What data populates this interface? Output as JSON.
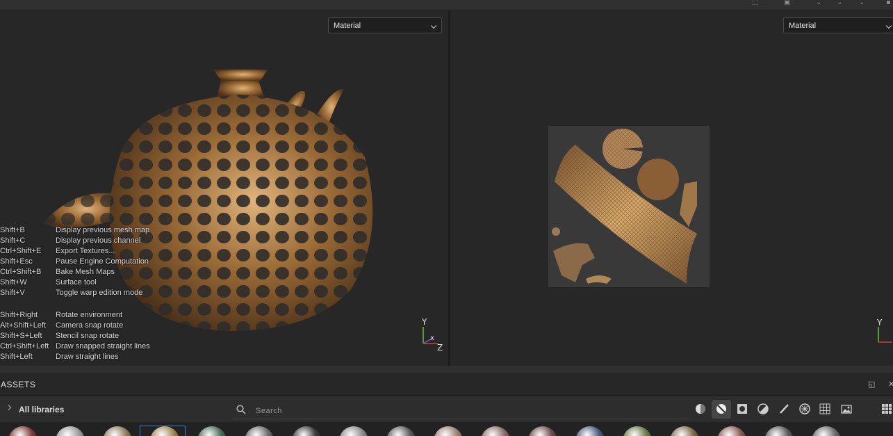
{
  "viewport3d": {
    "channel_dropdown": "Material"
  },
  "viewport2d": {
    "channel_dropdown": "Material"
  },
  "shortcuts_group1": [
    {
      "key": "Shift+B",
      "action": "Display previous mesh map"
    },
    {
      "key": "Shift+C",
      "action": "Display previous channel"
    },
    {
      "key": "Ctrl+Shift+E",
      "action": "Export Textures..."
    },
    {
      "key": "Shift+Esc",
      "action": "Pause Engine Computation"
    },
    {
      "key": "Ctrl+Shift+B",
      "action": "Bake Mesh Maps"
    },
    {
      "key": "Shift+W",
      "action": "Surface tool"
    },
    {
      "key": "Shift+V",
      "action": "Toggle warp edition mode"
    }
  ],
  "shortcuts_group2": [
    {
      "key": "Shift+Right",
      "action": "Rotate environment"
    },
    {
      "key": "Alt+Shift+Left",
      "action": "Camera snap rotate"
    },
    {
      "key": "Shift+S+Left",
      "action": "Stencil snap rotate"
    },
    {
      "key": "Ctrl+Shift+Left",
      "action": "Draw snapped straight lines"
    },
    {
      "key": "Shift+Left",
      "action": "Draw straight lines"
    }
  ],
  "gizmo3d": {
    "y": "Y",
    "x": "x",
    "z": "Z"
  },
  "gizmo2d": {
    "y": "Y"
  },
  "assets": {
    "title": "ASSETS",
    "library": "All libraries",
    "search_placeholder": "Search"
  },
  "filters": [
    "materials-filter",
    "smart-materials-filter",
    "textures-filter",
    "masks-filter",
    "brushes-filter",
    "patterns-filter",
    "grids-filter",
    "environments-filter"
  ],
  "thumb_colors": [
    "#7a3a3a",
    "#9a9a9a",
    "#8a7a5a",
    "#a08850",
    "#4a6a5a",
    "#6a6a6a",
    "#3a3a3a",
    "#8a8a8a",
    "#5a5a5a",
    "#9a8070",
    "#8a6a6a",
    "#6a4a4a",
    "#4a5a7a",
    "#6a7a4a",
    "#7a6a4a",
    "#8a5a5a",
    "#5a5a5a",
    "#6a6a6a"
  ],
  "accent": "#3c7bd6"
}
